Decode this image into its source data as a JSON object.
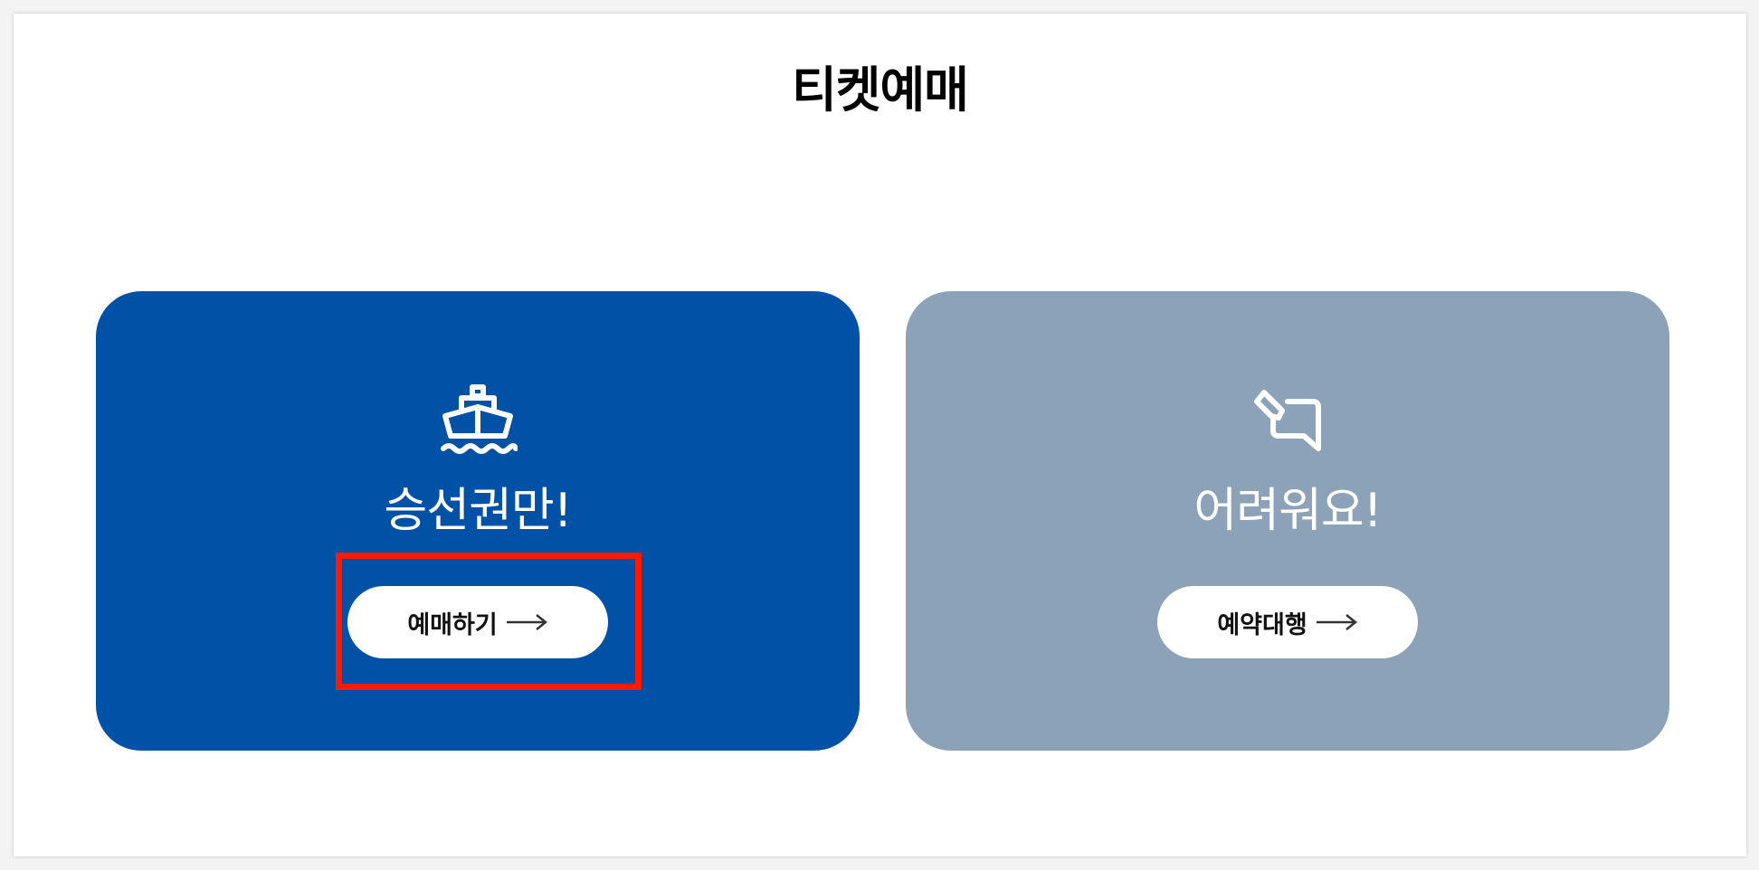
{
  "page": {
    "title": "티켓예매"
  },
  "cards": [
    {
      "heading": "승선권만!",
      "icon": "ship-icon",
      "button_label": "예매하기",
      "button_icon": "arrow-right-icon",
      "background": "#0152a6",
      "highlighted": true
    },
    {
      "heading": "어려워요!",
      "icon": "pencil-note-icon",
      "button_label": "예약대행",
      "button_icon": "arrow-right-icon",
      "background": "#8ba2b8",
      "highlighted": false
    }
  ],
  "colors": {
    "highlight": "#ff1a00",
    "button_bg": "#ffffff",
    "text_on_card": "#ffffff"
  }
}
